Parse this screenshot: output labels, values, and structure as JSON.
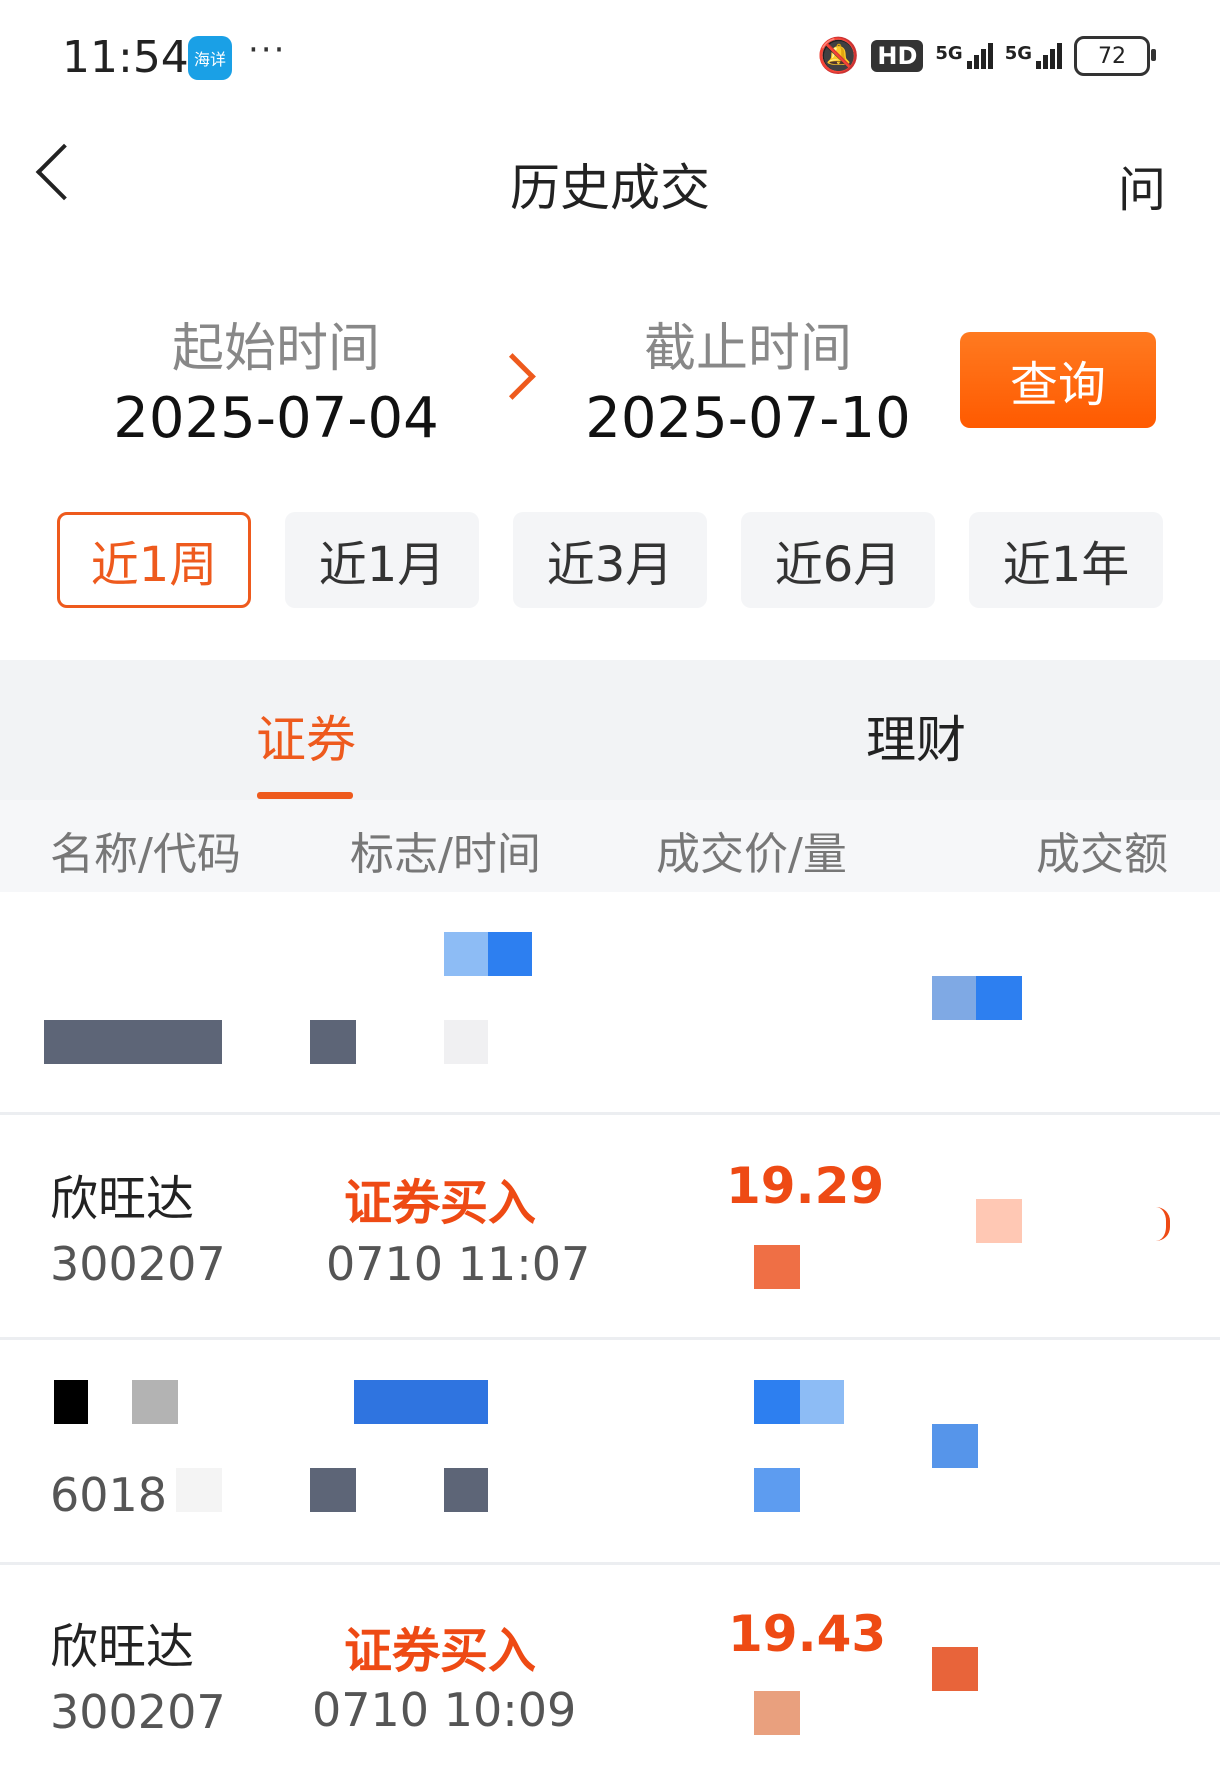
{
  "status_bar": {
    "time": "11:54",
    "app_badge": "海详",
    "more": "···",
    "hd_label": "HD",
    "net1_label": "5G",
    "net2_label": "5G",
    "battery": "72"
  },
  "nav": {
    "title": "历史成交",
    "help_label": "问"
  },
  "date_range": {
    "start_label": "起始时间",
    "start_value": "2025-07-04",
    "end_label": "截止时间",
    "end_value": "2025-07-10",
    "query_label": "查询"
  },
  "periods": [
    {
      "label": "近1周",
      "active": true
    },
    {
      "label": "近1月",
      "active": false
    },
    {
      "label": "近3月",
      "active": false
    },
    {
      "label": "近6月",
      "active": false
    },
    {
      "label": "近1年",
      "active": false
    }
  ],
  "tabs": [
    {
      "label": "证券",
      "active": true
    },
    {
      "label": "理财",
      "active": false
    }
  ],
  "columns": [
    "名称/代码",
    "标志/时间",
    "成交价/量",
    "成交额"
  ],
  "rows": [
    {
      "name": "欣旺达",
      "code": "300207",
      "flag": "证券买入",
      "time": "0710 11:07",
      "price": "19.29"
    },
    {
      "code": "6018"
    },
    {
      "name": "欣旺达",
      "code": "300207",
      "flag": "证券买入",
      "time": "0710 10:09",
      "price": "19.43"
    }
  ],
  "colors": {
    "accent": "#ee5a1d",
    "buy_red": "#ee4a14",
    "mosaic_blue": "#2f7fe8",
    "mosaic_gray": "#5d6577"
  }
}
